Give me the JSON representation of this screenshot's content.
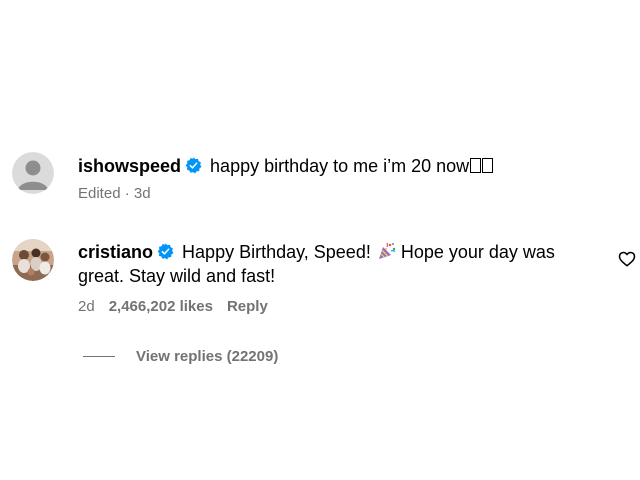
{
  "comments": [
    {
      "username": "ishowspeed",
      "verified": true,
      "text": "happy birthday to me i’m 20 now",
      "trailing_glyph": "square-box-glyph",
      "meta": {
        "edited": "Edited",
        "separator": " · ",
        "time": "3d"
      },
      "avatar_icon": "default-avatar-icon"
    },
    {
      "username": "cristiano",
      "verified": true,
      "text_before_emoji": "Happy Birthday, Speed!",
      "emoji_icon": "party-popper-icon",
      "text_after_emoji": "Hope your day was great. Stay wild and fast!",
      "meta": {
        "time": "2d",
        "likes": "2,466,202 likes",
        "reply": "Reply"
      },
      "avatar_icon": "profile-photo",
      "like_icon": "heart-icon"
    }
  ],
  "view_replies": {
    "label": "View replies (22209)"
  },
  "colors": {
    "verified_badge": "#0095f6",
    "meta_text": "#737373",
    "default_avatar_bg": "#dbdbdb",
    "default_avatar_fg": "#8e8e8e"
  }
}
